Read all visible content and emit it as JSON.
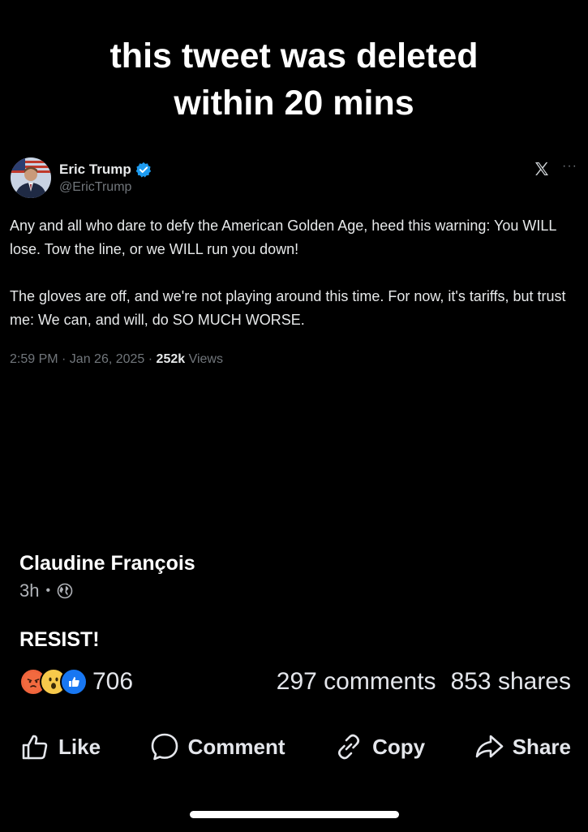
{
  "caption": {
    "line1": "this tweet was deleted",
    "line2": "within 20 mins"
  },
  "tweet": {
    "name": "Eric Trump",
    "handle": "@EricTrump",
    "paragraph1": "Any and all who dare to defy the American Golden Age, heed this warning: You WILL lose. Tow the line, or we WILL run you down!",
    "paragraph2": "The gloves are off, and we're not playing around this time. For now, it's tariffs, but trust me: We can, and will, do SO MUCH WORSE.",
    "time": "2:59 PM · Jan 26, 2025 · ",
    "views_count": "252k",
    "views_label": " Views",
    "more": "···"
  },
  "post": {
    "author": "Claudine François",
    "time": "3h",
    "dot": "•",
    "text": "RESIST!",
    "reaction_count": "706",
    "comments": "297 comments",
    "shares": "853 shares"
  },
  "actions": {
    "like": "Like",
    "comment": "Comment",
    "copy": "Copy",
    "share": "Share"
  },
  "colors": {
    "background": "#000000",
    "verified": "#1d9bf0",
    "like_blue": "#1877f2",
    "angry": "#f0643c",
    "wow": "#f7c94b",
    "muted": "#71767b"
  }
}
